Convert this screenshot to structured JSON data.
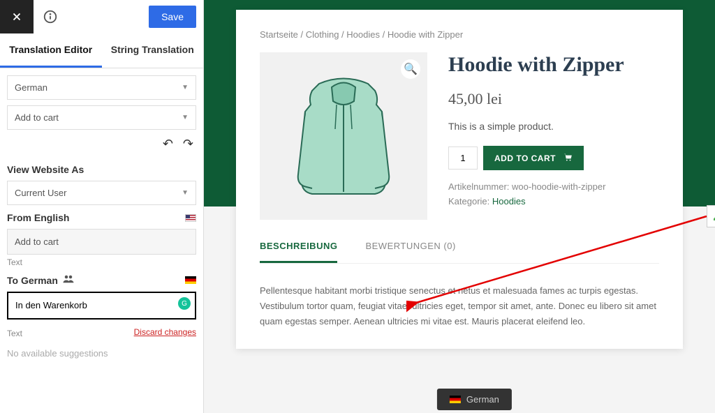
{
  "toolbar": {
    "save_label": "Save"
  },
  "tabs": {
    "editor": "Translation Editor",
    "string": "String Translation"
  },
  "selects": {
    "language": "German",
    "string_select": "Add to cart"
  },
  "view_as": {
    "label": "View Website As",
    "value": "Current User"
  },
  "from": {
    "label": "From English",
    "value": "Add to cart",
    "type": "Text"
  },
  "to": {
    "label": "To German",
    "value": "In den Warenkorb",
    "type": "Text",
    "discard": "Discard changes"
  },
  "suggestions": "No available suggestions",
  "product": {
    "breadcrumb": "Startseite / Clothing / Hoodies / Hoodie with Zipper",
    "title": "Hoodie with Zipper",
    "price": "45,00 lei",
    "short_desc": "This is a simple product.",
    "qty": "1",
    "add_to_cart": "ADD TO CART",
    "sku_label": "Artikelnummer:",
    "sku": "woo-hoodie-with-zipper",
    "cat_label": "Kategorie:",
    "cat": "Hoodies",
    "tab_desc": "BESCHREIBUNG",
    "tab_reviews": "BEWERTUNGEN (0)",
    "long_desc": "Pellentesque habitant morbi tristique senectus et netus et malesuada fames ac turpis egestas. Vestibulum tortor quam, feugiat vitae, ultricies eget, tempor sit amet, ante. Donec eu libero sit amet quam egestas semper. Aenean ultricies mi vitae est. Mauris placerat eleifend leo."
  },
  "lang_switch": "German"
}
